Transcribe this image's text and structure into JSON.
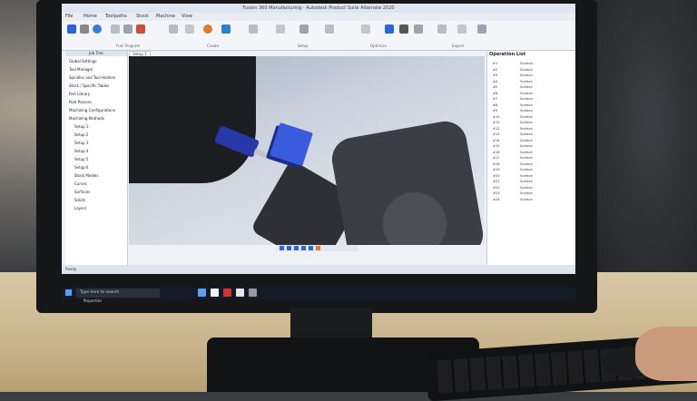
{
  "app": {
    "title": "Fusion 360 Manufacturing - Autodesk Product Suite Alternate 2020",
    "ribbon_tabs": [
      "File",
      "Home",
      "Toolpaths",
      "Stock",
      "Machine",
      "View"
    ],
    "ribbon_groups": [
      "Fuel Program",
      "Create",
      "Setup",
      "Optimize",
      "Export"
    ],
    "tree_header": "Job Tree",
    "tree_items": [
      "Global Settings",
      "Tool Manager",
      "Spindles and Tool Holders",
      "Stock / Specific Tables",
      "Part Library",
      "Post Process",
      "Machining Configurations",
      "Machining Methods",
      "Setup 1",
      "Setup 2",
      "Setup 3",
      "Setup 4",
      "Setup 5",
      "Setup 6",
      "Stock Models",
      "Curves",
      "Surfaces",
      "Solids",
      "Layers"
    ],
    "viewport_tab": "Setup 1"
  },
  "oplist": {
    "title": "Operation List",
    "rows": [
      {
        "num": "#1",
        "type": "Surface"
      },
      {
        "num": "#2",
        "type": "Surface"
      },
      {
        "num": "#3",
        "type": "Surface"
      },
      {
        "num": "#4",
        "type": "Surface"
      },
      {
        "num": "#5",
        "type": "Surface"
      },
      {
        "num": "#6",
        "type": "Surface"
      },
      {
        "num": "#7",
        "type": "Surface"
      },
      {
        "num": "#8",
        "type": "Surface"
      },
      {
        "num": "#9",
        "type": "Surface"
      },
      {
        "num": "#10",
        "type": "Surface"
      },
      {
        "num": "#11",
        "type": "Surface"
      },
      {
        "num": "#12",
        "type": "Surface"
      },
      {
        "num": "#13",
        "type": "Surface"
      },
      {
        "num": "#14",
        "type": "Surface"
      },
      {
        "num": "#15",
        "type": "Surface"
      },
      {
        "num": "#16",
        "type": "Surface"
      },
      {
        "num": "#17",
        "type": "Surface"
      },
      {
        "num": "#18",
        "type": "Surface"
      },
      {
        "num": "#19",
        "type": "Surface"
      },
      {
        "num": "#20",
        "type": "Surface"
      },
      {
        "num": "#21",
        "type": "Surface"
      },
      {
        "num": "#22",
        "type": "Surface"
      },
      {
        "num": "#23",
        "type": "Surface"
      },
      {
        "num": "#24",
        "type": "Surface"
      }
    ]
  },
  "statusbar": {
    "text": "Ready"
  },
  "taskbar": {
    "search": "Type here to search",
    "bottom_text": "Properties"
  },
  "colors": {
    "accent": "#2b65d9",
    "part": "#3a5bde",
    "spindle": "#2838a8"
  }
}
